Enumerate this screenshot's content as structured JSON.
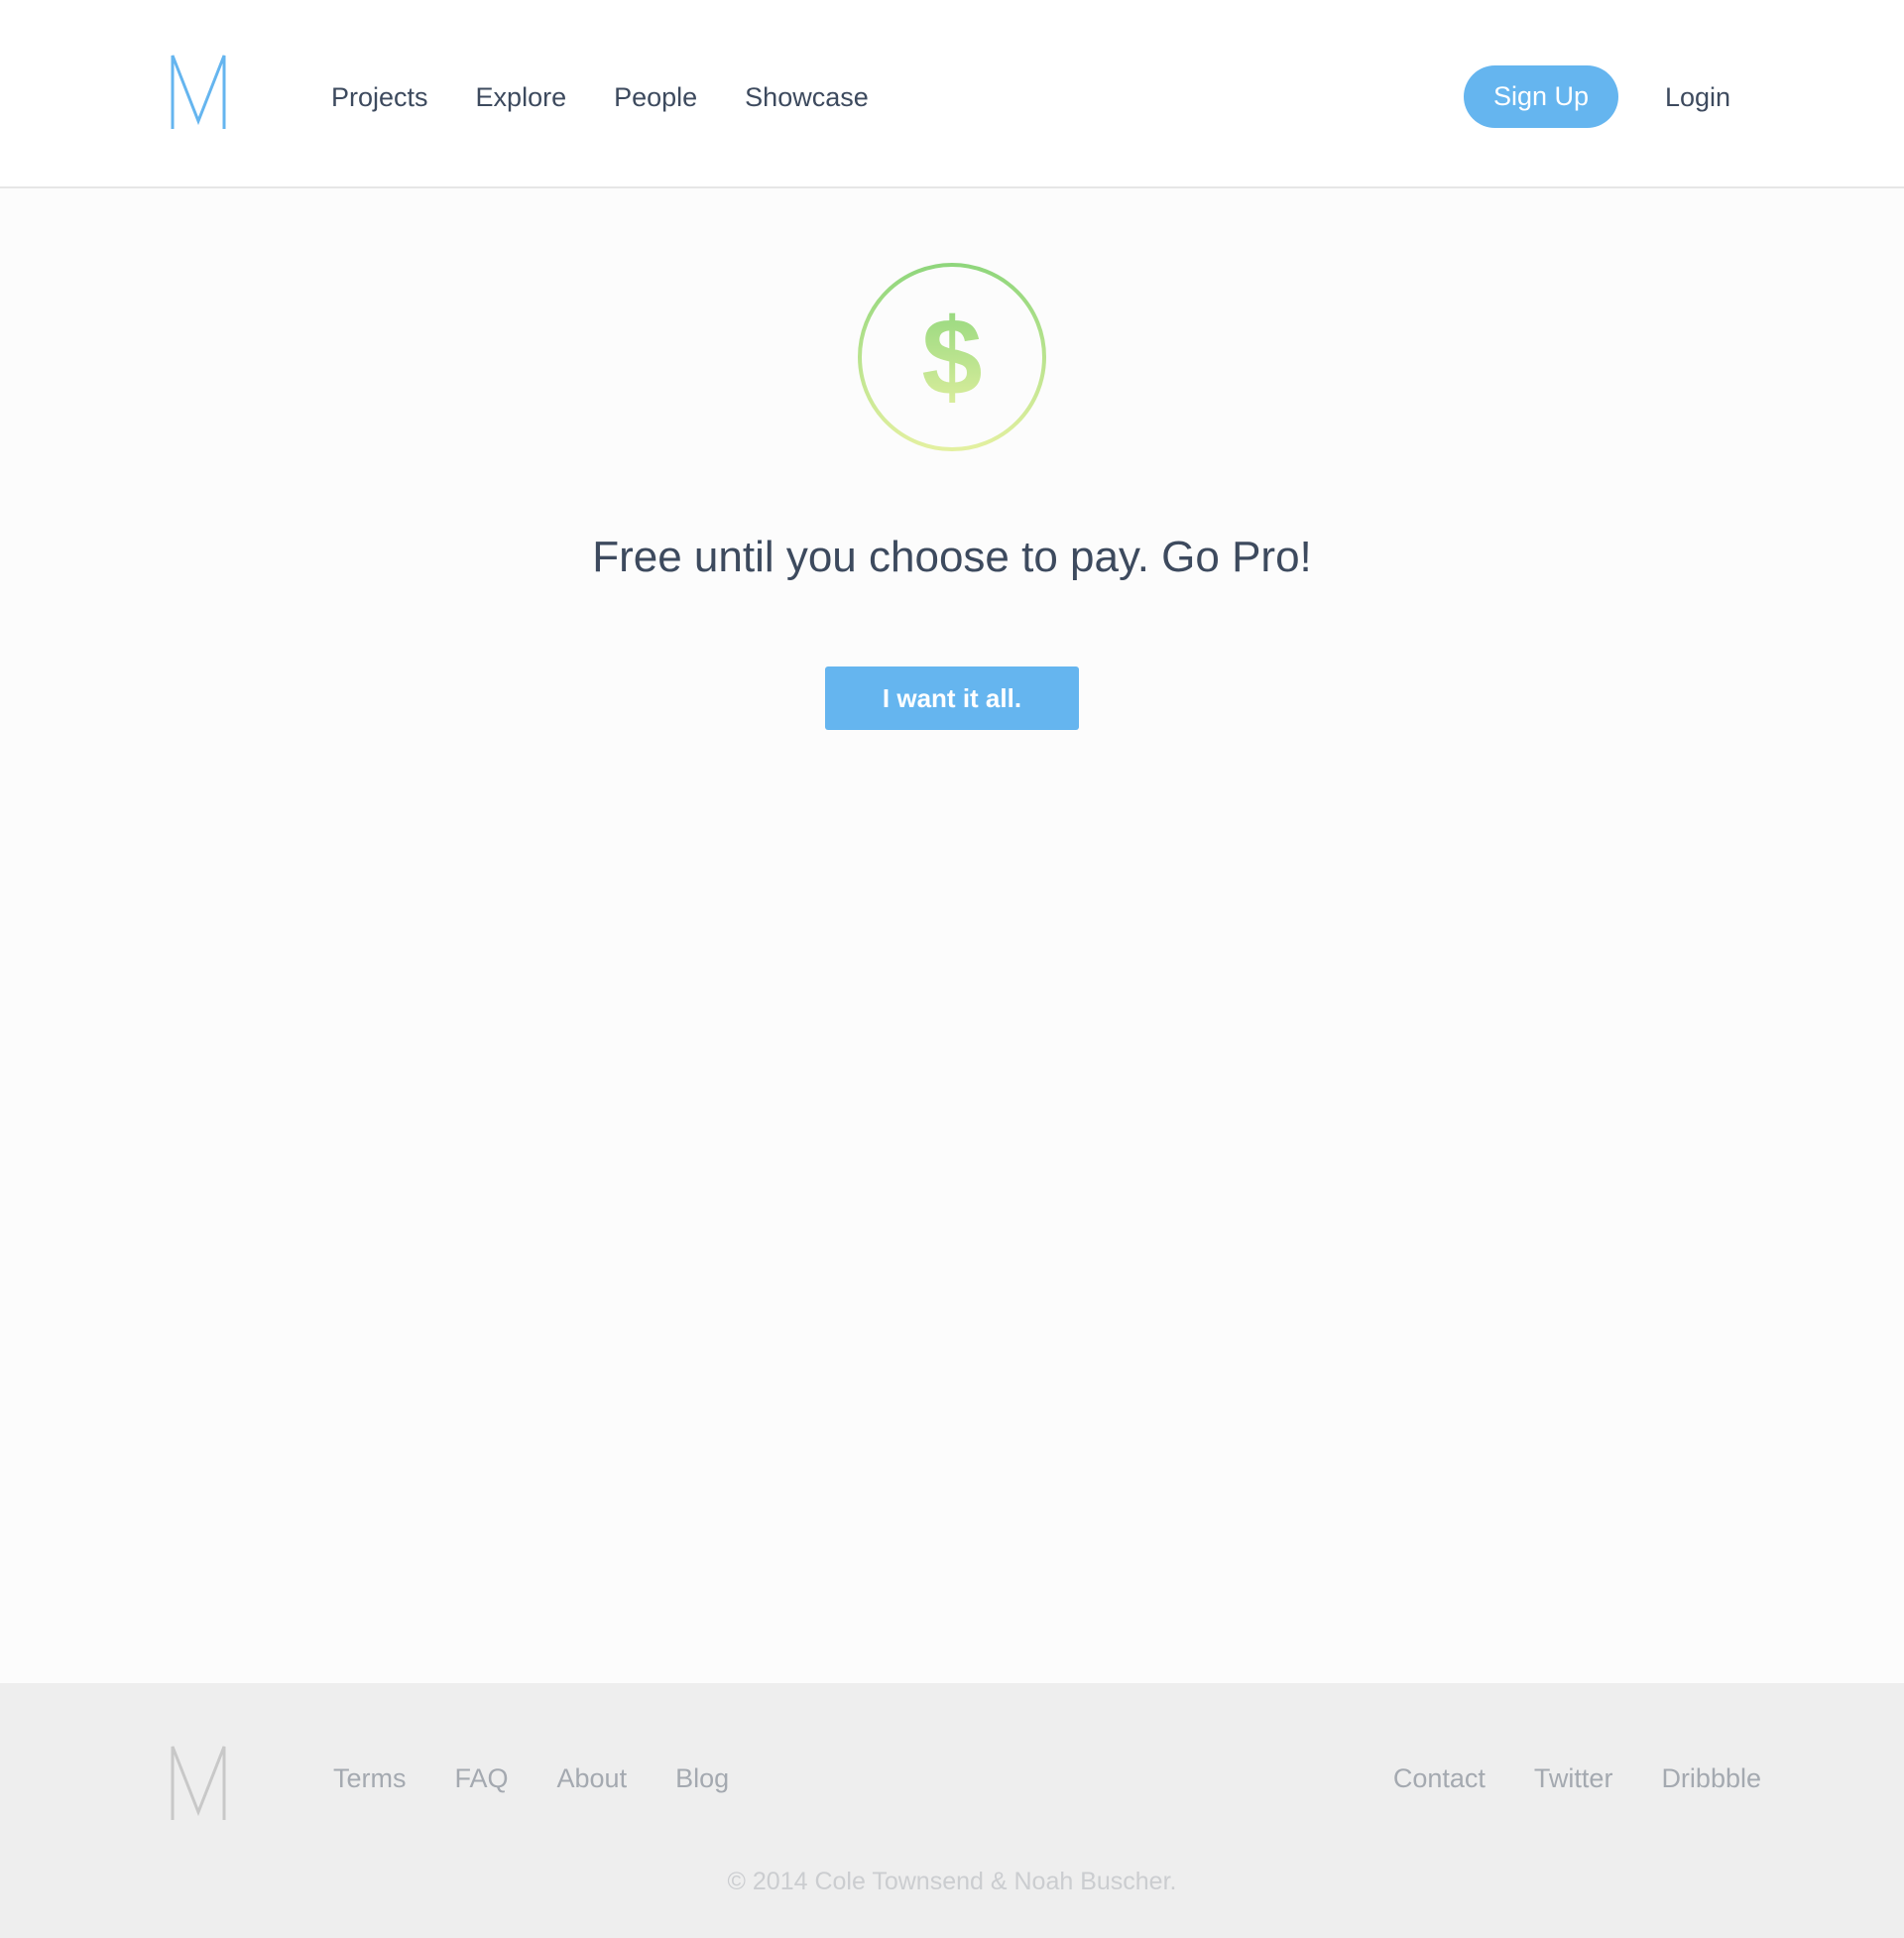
{
  "header": {
    "logo_letter": "M",
    "nav": [
      {
        "label": "Projects"
      },
      {
        "label": "Explore"
      },
      {
        "label": "People"
      },
      {
        "label": "Showcase"
      }
    ],
    "signup_label": "Sign Up",
    "login_label": "Login"
  },
  "main": {
    "icon": "dollar-coin-icon",
    "headline": "Free until you choose to pay. Go Pro!",
    "cta_label": "I want it all."
  },
  "footer": {
    "logo_letter": "M",
    "left_links": [
      {
        "label": "Terms"
      },
      {
        "label": "FAQ"
      },
      {
        "label": "About"
      },
      {
        "label": "Blog"
      }
    ],
    "right_links": [
      {
        "label": "Contact"
      },
      {
        "label": "Twitter"
      },
      {
        "label": "Dribbble"
      }
    ],
    "copyright": "© 2014 Cole Townsend & Noah Buscher."
  },
  "colors": {
    "accent": "#65b5ef",
    "text": "#3d4a5e",
    "coin_green": "#8fd67c",
    "coin_yellow": "#e3f0a0",
    "footer_bg": "#eeeeee"
  }
}
